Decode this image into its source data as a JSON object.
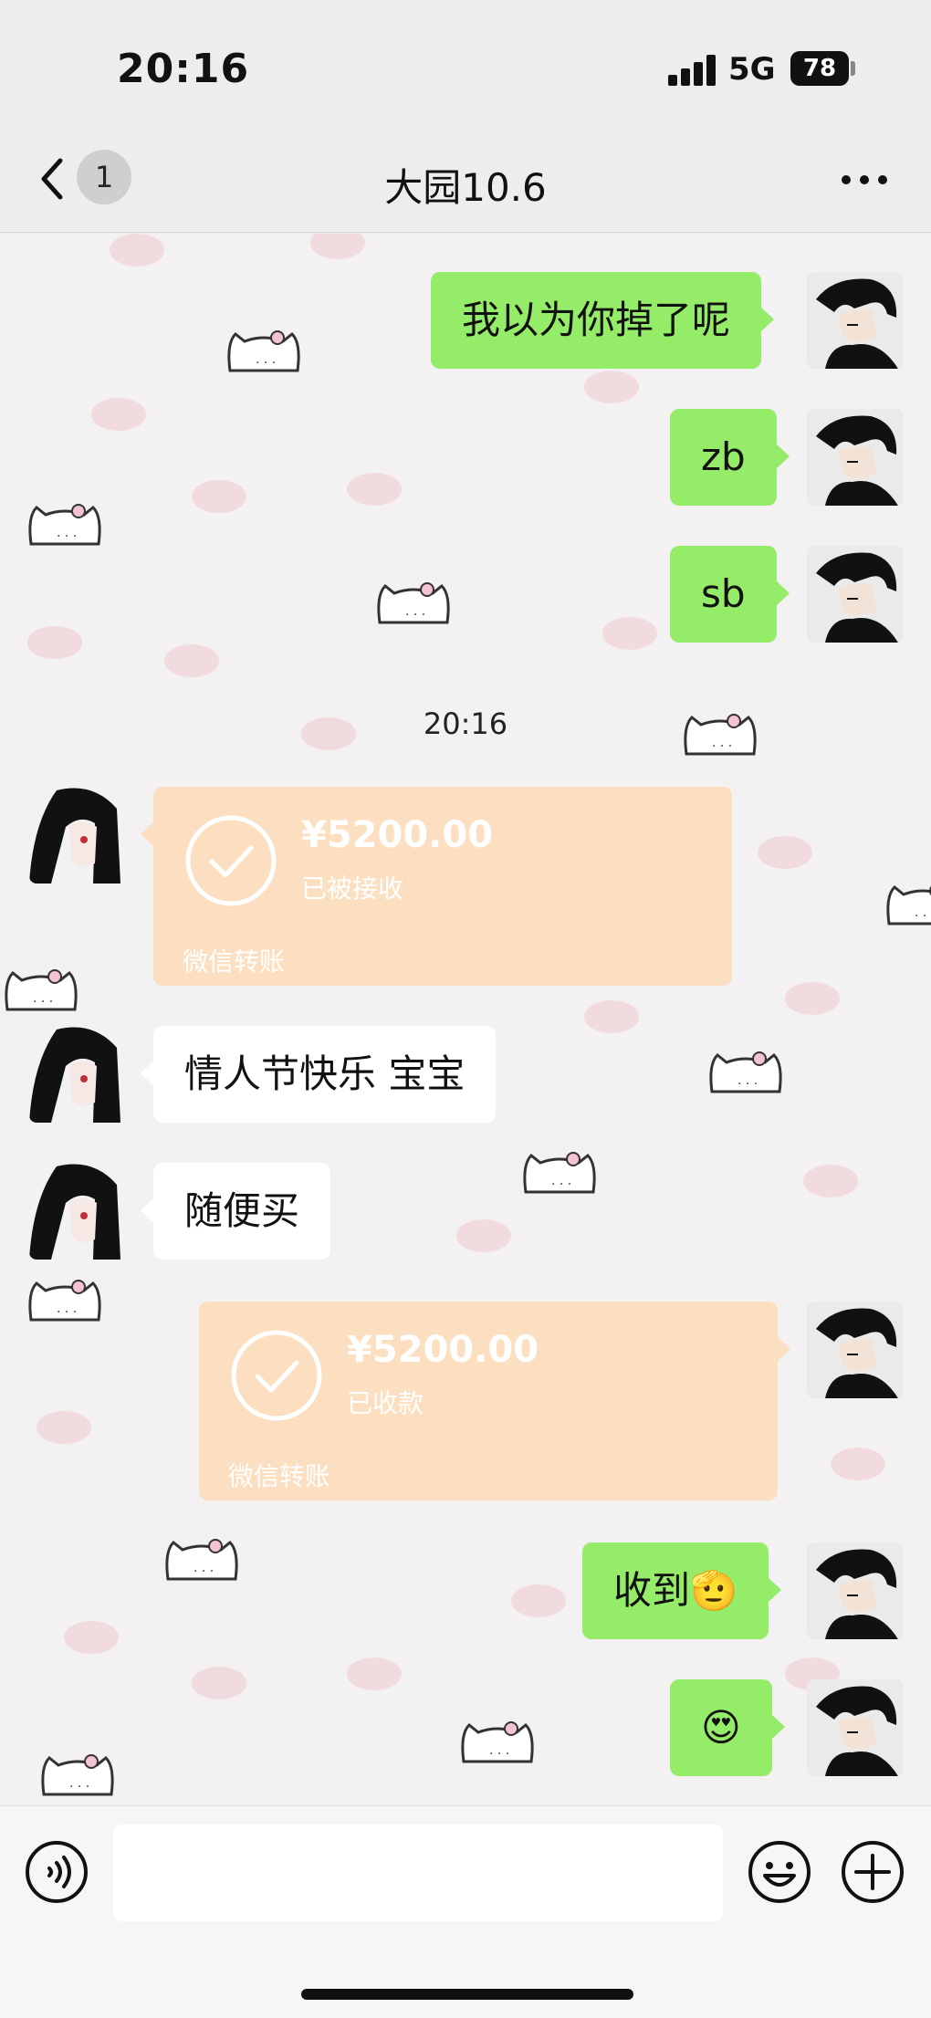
{
  "status_bar": {
    "time": "20:16",
    "network": "5G",
    "battery": "78"
  },
  "nav": {
    "back_icon": "chevron-left-icon",
    "unread_count": "1",
    "title": "大园10.6",
    "more_icon": "more-dots-icon"
  },
  "messages": {
    "m1": {
      "sender": "me",
      "text": "我以为你掉了呢"
    },
    "m2": {
      "sender": "me",
      "text": "zb"
    },
    "m3": {
      "sender": "me",
      "text": "sb"
    },
    "timestamp": "20:16",
    "transfer1": {
      "sender": "them",
      "amount": "¥5200.00",
      "status": "已被接收",
      "brand": "微信转账"
    },
    "m4": {
      "sender": "them",
      "text": "情人节快乐 宝宝"
    },
    "m5": {
      "sender": "them",
      "text": "随便买"
    },
    "transfer2": {
      "sender": "me",
      "amount": "¥5200.00",
      "status": "已收款",
      "brand": "微信转账"
    },
    "m6": {
      "sender": "me",
      "text": "收到",
      "emoji": "🫡"
    },
    "m7": {
      "sender": "me",
      "emoji": "😍"
    }
  },
  "input_bar": {
    "voice_icon": "voice-icon",
    "placeholder": "",
    "emoji_icon": "smiley-icon",
    "plus_icon": "plus-icon"
  },
  "colors": {
    "my_bubble": "#95ec69",
    "their_bubble": "#ffffff",
    "transfer_card": "#fbdfc0",
    "nav_background": "#ededed"
  }
}
